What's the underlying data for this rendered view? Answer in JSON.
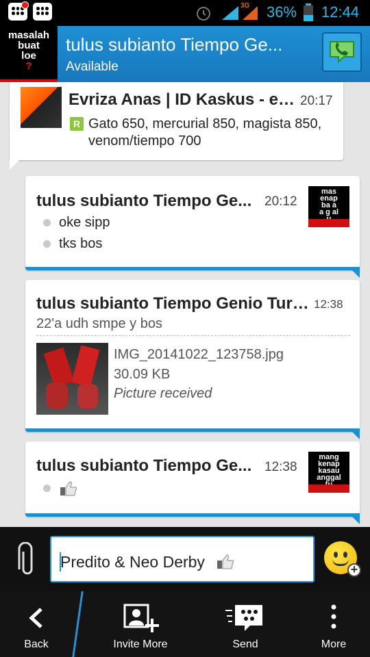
{
  "status_bar": {
    "battery": "36%",
    "clock": "12:44",
    "network": "3G"
  },
  "header": {
    "avatar_lines": [
      "masalah",
      "buat",
      "loe",
      "?"
    ],
    "title": "tulus subianto Tiempo Ge...",
    "status": "Available",
    "accent_color": "#1a82c8"
  },
  "messages": [
    {
      "sender": "Evriza Anas | ID Kaskus - ev...",
      "time": "20:17",
      "badge": "R",
      "lines": [
        "Gato 650, mercurial 850, magista 850,",
        "venom/tiempo 700"
      ]
    },
    {
      "sender": "tulus subianto Tiempo Ge...",
      "time": "20:12",
      "lines": [
        "oke sipp",
        "tks bos"
      ],
      "avatar_text": [
        "mas",
        "enap",
        "ba a",
        "a g al",
        "u"
      ]
    },
    {
      "sender": "tulus subianto Tiempo Genio Turq (...",
      "time": "12:38",
      "lines": [
        "22'a udh smpe y bos"
      ],
      "attachment": {
        "filename": "IMG_20141022_123758.jpg",
        "size": "30.09 KB",
        "status": "Picture received"
      }
    },
    {
      "sender": "tulus subianto Tiempo Ge...",
      "time": "12:38",
      "lines": [],
      "avatar_text": [
        "mang",
        "kenap",
        "kasau",
        "anggal",
        "tu"
      ]
    }
  ],
  "composer": {
    "value": "Predito & Neo Derby"
  },
  "nav": {
    "back": "Back",
    "invite": "Invite More",
    "send": "Send",
    "more": "More"
  }
}
